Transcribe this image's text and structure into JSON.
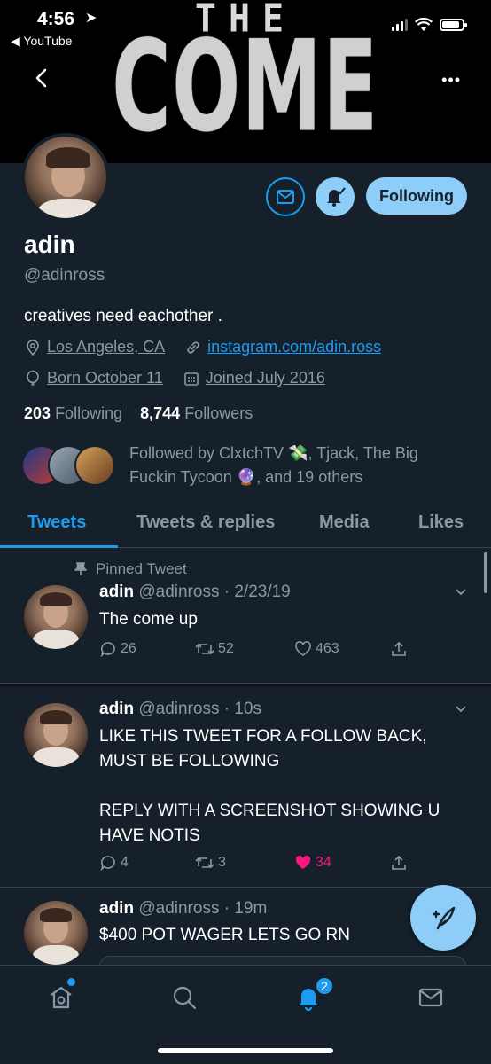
{
  "status_bar": {
    "time": "4:56",
    "back_app": "YouTube"
  },
  "banner": {
    "line1": "THE",
    "line2": "COME UP"
  },
  "profile": {
    "name": "adin",
    "handle": "@adinross",
    "bio": "creatives need eachother .",
    "location": "Los Angeles, CA",
    "website": "instagram.com/adin.ross",
    "birthday": "Born October 11",
    "joined": "Joined July 2016",
    "following_count": "203",
    "following_label": "Following",
    "followers_count": "8,744",
    "followers_label": "Followers",
    "followed_by": "Followed by ClxtchTV 💸, Tjack, The Big Fuckin Tycoon 🔮, and 19 others",
    "follow_button": "Following"
  },
  "tabs": [
    "Tweets",
    "Tweets & replies",
    "Media",
    "Likes"
  ],
  "tweets": [
    {
      "pinned_label": "Pinned Tweet",
      "name": "adin",
      "handle": "@adinross",
      "time": "2/23/19",
      "text": "The come up",
      "replies": "26",
      "retweets": "52",
      "likes": "463"
    },
    {
      "name": "adin",
      "handle": "@adinross",
      "time": "10s",
      "text": "LIKE THIS TWEET FOR A FOLLOW BACK, MUST BE FOLLOWING\n\nREPLY WITH A SCREENSHOT SHOWING U HAVE NOTIS",
      "replies": "4",
      "retweets": "3",
      "likes": "34"
    },
    {
      "name": "adin",
      "handle": "@adinross",
      "time": "19m",
      "text": "$400 POT WAGER LETS GO RN"
    }
  ],
  "nav": {
    "notification_count": "2"
  },
  "colors": {
    "background": "#15202b",
    "accent": "#1d9bf0",
    "like": "#f91880",
    "muted": "#8899a6"
  }
}
